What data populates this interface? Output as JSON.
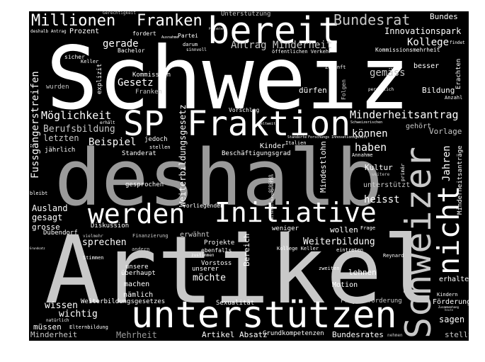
{
  "cloud": {
    "background": "#000000",
    "colors": {
      "light": "#ffffff",
      "mid": "#c8c8c8",
      "dark": "#9a9a9a"
    },
    "words": {
      "schweiz": "Schweiz",
      "deshalb": "deshalb",
      "artikel": "Artikel",
      "unterstuetzen": "unterstützen",
      "bereit": "bereit",
      "sp": "SP",
      "fraktion": "Fraktion",
      "initiative": "Initiative",
      "werden": "werden",
      "schweizer": "Schweizer",
      "nicht": "nicht",
      "millionen": "Millionen",
      "franken_big": "Franken",
      "bundesrat": "Bundesrat",
      "bundes": "Bundes",
      "innovationspark": "Innovationspark",
      "kollege": "Kollege",
      "antrag_minderheit": "Antrag Minderheit",
      "gerade": "gerade",
      "gesetz": "Gesetz",
      "moeglichkeit": "Möglichkeit",
      "berufsbildung": "Berufsbildung",
      "letzten": "letzten",
      "beispiel": "Beispiel",
      "minderheitsantrag": "Minderheitsantrag",
      "koennen": "können",
      "haben": "haben",
      "heisst": "heisst",
      "gemaess": "gemäss",
      "besser": "besser",
      "bildung": "Bildung",
      "vorlage": "Vorlage",
      "gehoert": "gehört",
      "jahren": "Jahren",
      "kultur": "Kultur",
      "unterstuetzt": "unterstützt",
      "ausland": "Ausland",
      "gesagt": "gesagt",
      "grosse": "grosse",
      "sprechen": "sprechen",
      "wissen": "wissen",
      "wichtig": "wichtig",
      "muessen": "müssen",
      "minderheit": "Minderheit",
      "mehrheit": "Mehrheit",
      "moechte": "möchte",
      "weiterbildung": "Weiterbildung",
      "wollen": "wollen",
      "lehnen": "lehnen",
      "motion": "Motion",
      "erhalten": "erhalten",
      "foerderung": "Förderung",
      "sagen": "sagen",
      "stellt": "stellt",
      "bundesrates": "Bundesrates",
      "artikel_absatz": "Artikel Absatz",
      "grundkompetenzen": "Grundkompetenzen",
      "projektfoerderung": "Projektförderung",
      "sexualitaet": "Sexualität",
      "weiterbildungsgesetzes": "Weiterbildungsgesetzes",
      "naemlich": "nämlich",
      "machen": "machen",
      "unsere": "unsere",
      "ueberhaupt": "überhaupt",
      "vorstoss": "Vorstoss",
      "unserer": "unserer",
      "projekte": "Projekte",
      "erwaehnt": "erwähnt",
      "ebenfalls": "ebenfalls",
      "finanzierung": "Finanzierung",
      "diskussion": "Diskussion",
      "duebendorf": "Dübendorf",
      "stimmen": "Stimmen",
      "vielmehr": "vielmehr",
      "andern": "andern",
      "gesprochen": "gesprochen",
      "vorliegenden": "vorliegenden",
      "weniger": "weniger",
      "bereich": "Bereich",
      "frage": "Frage",
      "kollege_keller": "Kollege Keller",
      "eintreten": "eintreten",
      "reynard": "Reynard",
      "zweiten": "zweiten",
      "mindestlohn": "Mindestlohn",
      "kinder": "Kinder",
      "italien": "Italien",
      "beschaeftigungsgrad": "Beschäftigungsgrad",
      "annahme": "Annahme",
      "standerat": "Standerat",
      "stellen": "stellen",
      "jedoch": "jedoch",
      "vorschlag": "Vorschlag",
      "weiterbildungsgesetz": "Weiterbildungsgesetz",
      "fussgaengerstreifen": "Fussgängerstreifen",
      "jaehrlich": "jährlich",
      "bleibt": "bleibt",
      "wurden": "wurden",
      "kommission": "Kommission",
      "franken_small": "Franken",
      "explizit": "explizit",
      "keller": "Keller",
      "sicher": "sicher",
      "bachelor": "Bachelor",
      "prozent": "Prozent",
      "fordert": "fordert",
      "partei": "Partei",
      "darum": "darum",
      "sinnvoll": "sinnvoll",
      "unterstuetzung": "Unterstützung",
      "gerechtigkeit": "Gerechtigkeit",
      "deshalb_antrag": "deshalb Antrag",
      "ausnahme": "Ausnahme",
      "projekten": "Projekten",
      "oeffentlichen_verkehr": "öffentlichen Verkehr",
      "kommissionsmehrheit": "Kommissionsmehrheit",
      "zukunft": "Zukunft",
      "folgen": "Folgen",
      "duerfen": "dürfen",
      "persoenlich": "persönlich",
      "anzahl": "Anzahl",
      "erachten": "Erachten",
      "findet": "findet",
      "minderheitsantraege": "Minderheitsanträge",
      "primaer": "primär",
      "weitere": "weitere",
      "kindern": "Kindern",
      "zusammenhang": "Zusammenhang",
      "heute": "heute",
      "nehmen": "nehmen",
      "eltern_bildung": "Elternbildung",
      "natuerlich": "natürlich",
      "erhaelt": "erhält",
      "grundsatz": "Grundsatz",
      "grossen": "grossen",
      "weiterbildungsgesetzes_small": "Weiterbildungsgesetzes",
      "weltweit": "Weltweit",
      "schweizerischen": "Schweizerischen",
      "standorte": "Standorte",
      "forschungs_innovationsgesetz": "Forschungs Innovationsgesetz",
      "zustimmen": "zustimmen"
    }
  }
}
